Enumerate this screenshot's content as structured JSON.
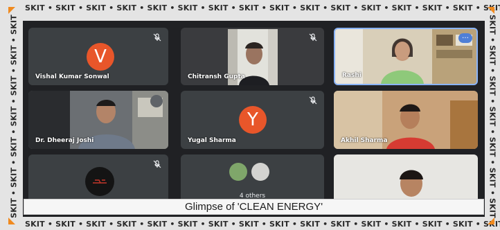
{
  "border": {
    "text": "SKIT • SKIT • SKIT • SKIT • SKIT • SKIT • SKIT • SKIT • SKIT • SKIT • SKIT • SKIT • SKIT • SKIT • SKIT • SKIT",
    "side_text": "SKIT • SKIT • SKIT • SKIT • SKIT • SKIT • SKIT",
    "accent_color": "#f08a1f"
  },
  "participants": [
    {
      "name": "Vishal Kumar Sonwal",
      "initial": "V",
      "muted": true,
      "avatar_color": "#e8562a"
    },
    {
      "name": "Chitransh Gupta",
      "muted": true,
      "video": true
    },
    {
      "name": "Rashi",
      "muted": false,
      "video": true
    },
    {
      "name": "Dr. Dheeraj Joshi",
      "muted": true,
      "video": true
    },
    {
      "name": "Yugal Sharma",
      "initial": "Y",
      "muted": true,
      "avatar_color": "#e8562a"
    },
    {
      "name": "Akhil Sharma",
      "muted": false,
      "video": true
    },
    {
      "name": "",
      "muted": true,
      "video": false
    },
    {
      "name": "4 others",
      "muted": false,
      "video": false
    },
    {
      "name": "",
      "muted": false,
      "video": true
    }
  ],
  "caption": "Glimpse of 'CLEAN ENERGY'",
  "more_icon": "…"
}
